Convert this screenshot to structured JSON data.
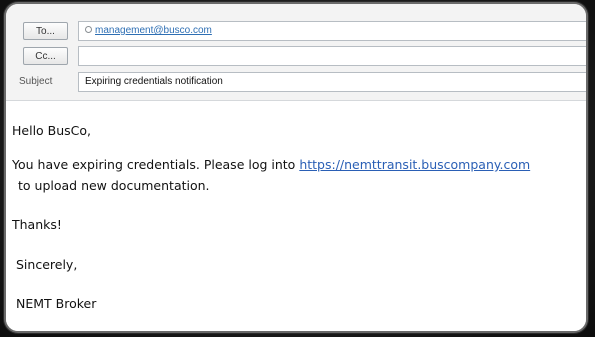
{
  "header": {
    "to_label": "To...",
    "cc_label": "Cc...",
    "subject_label": "Subject",
    "to_value": "management@busco.com",
    "cc_value": "",
    "subject_value": "Expiring credentials notification"
  },
  "message": {
    "greeting": "Hello BusCo,",
    "line1_text": "You have expiring credentials. Please log into ",
    "link": "https://nemttransit.buscompany.com",
    "line2": "to upload new documentation.",
    "thanks": "Thanks!",
    "closing": "Sincerely,",
    "signature": "NEMT Broker"
  },
  "colors": {
    "link": "#2a5fb5",
    "recipient": "#2e6fb4",
    "header_bg": "#f3f3f3"
  }
}
